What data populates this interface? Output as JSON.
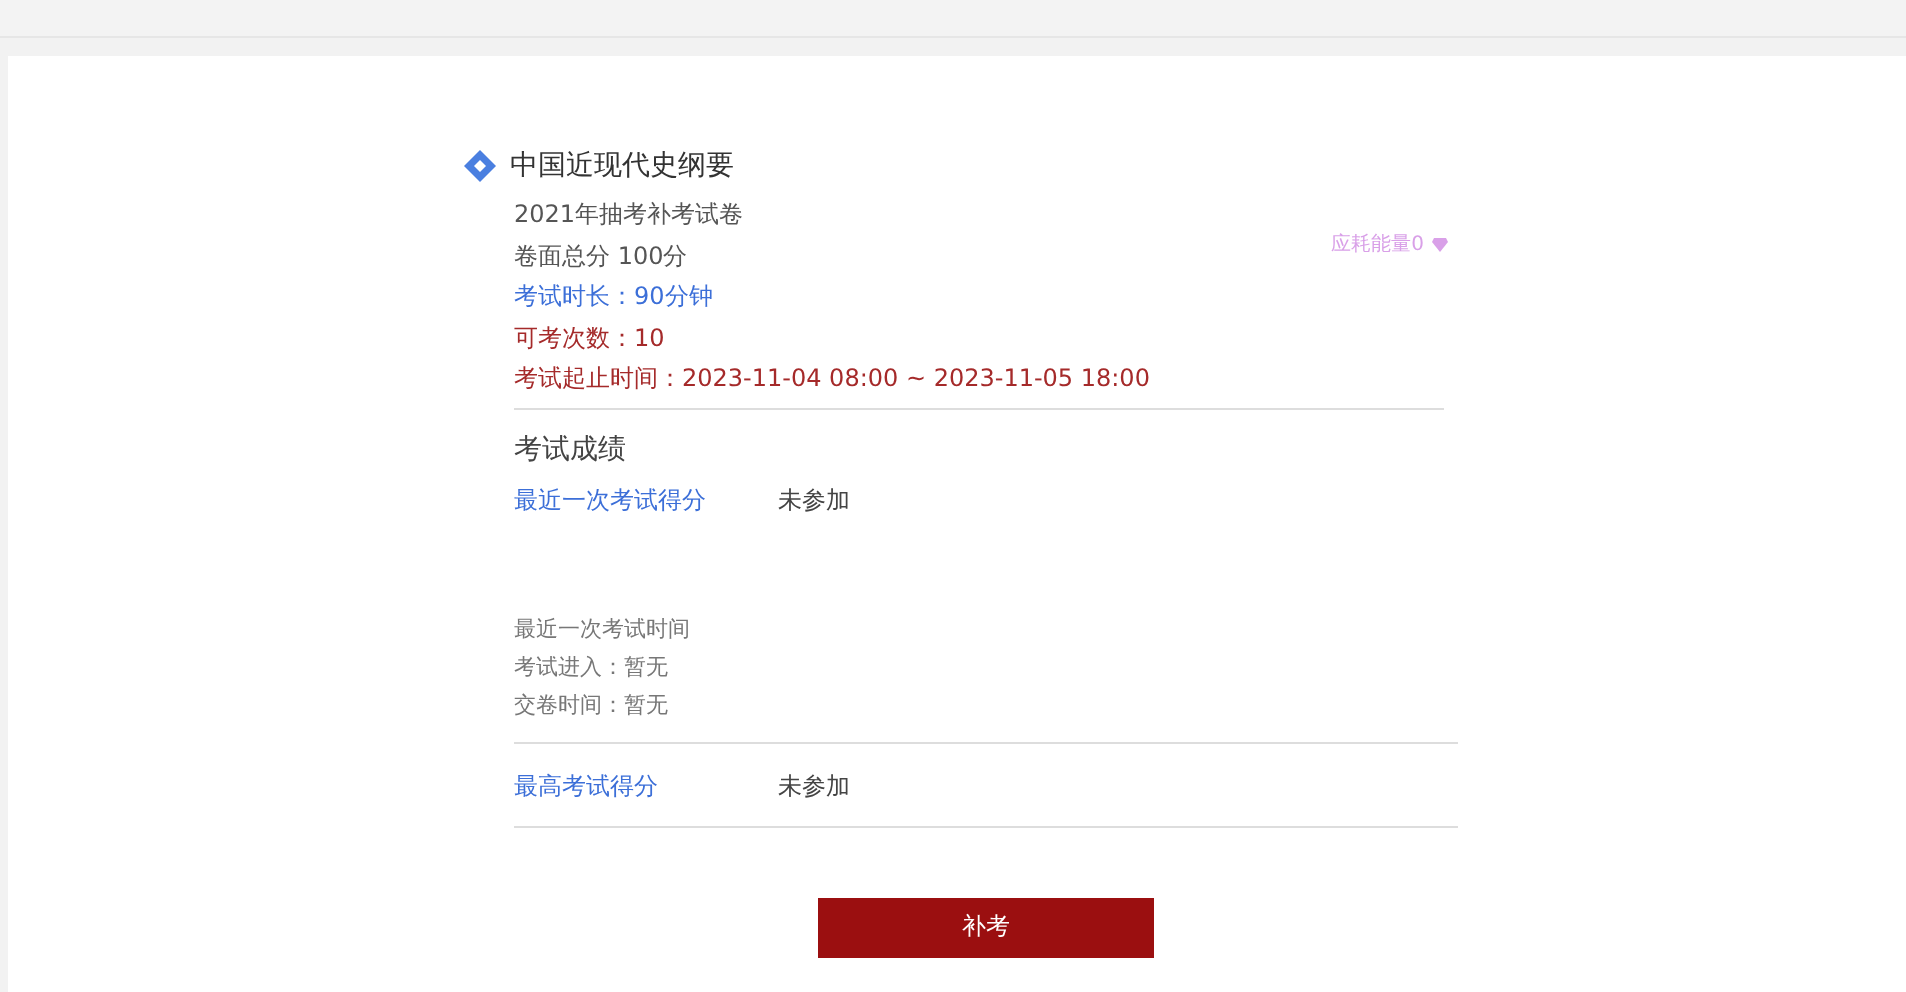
{
  "course": {
    "title": "中国近现代史纲要"
  },
  "info": [
    {
      "text": "2021年抽考补考试卷",
      "kind": "plain"
    },
    {
      "text": "卷面总分 100分",
      "kind": "plain"
    },
    {
      "text": "考试时长：90分钟",
      "kind": "blue"
    },
    {
      "text": "可考次数：10",
      "kind": "red"
    },
    {
      "text": "考试起止时间：2023-11-04 08:00 ~ 2023-11-05 18:00",
      "kind": "red"
    }
  ],
  "energy": {
    "text": "应耗能量0"
  },
  "results": {
    "title": "考试成绩",
    "latest": {
      "label": "最近一次考试得分",
      "value": "未参加"
    },
    "times": [
      "最近一次考试时间",
      "考试进入：暂无",
      "交卷时间：暂无"
    ],
    "best": {
      "label": "最高考试得分",
      "value": "未参加"
    }
  },
  "button": {
    "label": "补考"
  }
}
